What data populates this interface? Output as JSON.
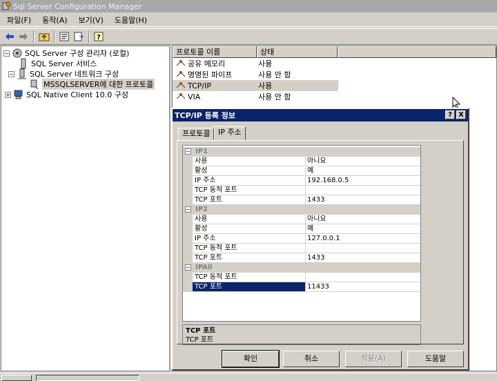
{
  "window": {
    "title": "Sql Server Configuration Manager"
  },
  "menu": [
    "파일(F)",
    "동작(A)",
    "보기(V)",
    "도움말(H)"
  ],
  "toolbar": {
    "icons": [
      "back-arrow-icon",
      "forward-arrow-icon",
      "up-folder-icon",
      "properties-icon",
      "export-list-icon",
      "help-icon"
    ]
  },
  "tree": {
    "root": "SQL Server 구성 관리자 (로컬)",
    "services": "SQL Server 서비스",
    "network": "SQL Server 네트워크 구성",
    "protocols": "MSSQLSERVER에 대한 프로토콜",
    "native_client": "SQL Native Client 10.0 구성"
  },
  "list": {
    "headers": [
      "프로토콜 이름",
      "상태"
    ],
    "rows": [
      {
        "name": "공유 메모리",
        "status": "사용"
      },
      {
        "name": "명명된 파이프",
        "status": "사용 안 함"
      },
      {
        "name": "TCP/IP",
        "status": "사용"
      },
      {
        "name": "VIA",
        "status": "사용 안 함"
      }
    ]
  },
  "dialog": {
    "title": "TCP/IP 등록 정보",
    "help_btn": "?",
    "close_btn": "X",
    "tabs": [
      "프로토콜",
      "IP 주소"
    ],
    "groups": [
      {
        "name": "IP1",
        "items": [
          {
            "label": "사용",
            "value": "아니요"
          },
          {
            "label": "활성",
            "value": "예"
          },
          {
            "label": "IP 주소",
            "value": "192.168.0.5"
          },
          {
            "label": "TCP 동적 포트",
            "value": ""
          },
          {
            "label": "TCP 포트",
            "value": "1433"
          }
        ]
      },
      {
        "name": "IP2",
        "items": [
          {
            "label": "사용",
            "value": "아니요"
          },
          {
            "label": "활성",
            "value": "예"
          },
          {
            "label": "IP 주소",
            "value": "127.0.0.1"
          },
          {
            "label": "TCP 동적 포트",
            "value": ""
          },
          {
            "label": "TCP 포트",
            "value": "1433"
          }
        ]
      },
      {
        "name": "IPAll",
        "items": [
          {
            "label": "TCP 동적 포트",
            "value": ""
          },
          {
            "label": "TCP 포트",
            "value": "11433"
          }
        ]
      }
    ],
    "description": {
      "title": "TCP 포트",
      "text": "TCP 포트"
    },
    "buttons": {
      "ok": "확인",
      "cancel": "취소",
      "apply": "적용(A)",
      "help": "도움말"
    }
  },
  "colors": {
    "selection": "#0a246a",
    "face": "#d4d0c8"
  }
}
